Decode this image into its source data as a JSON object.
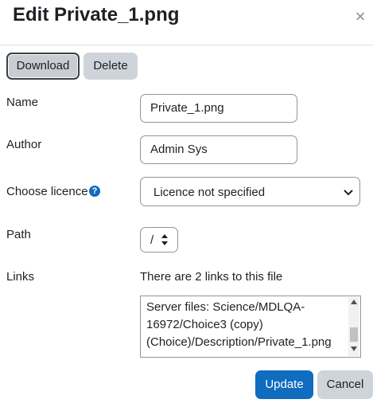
{
  "dialog": {
    "title": "Edit Private_1.png",
    "close_icon": "close-icon",
    "close_glyph": "×"
  },
  "toolbar": {
    "download_label": "Download",
    "delete_label": "Delete"
  },
  "form": {
    "name_label": "Name",
    "name_value": "Private_1.png",
    "author_label": "Author",
    "author_value": "Admin Sys",
    "licence_label": "Choose licence",
    "licence_help_icon": "question-circle-icon",
    "licence_help_glyph": "?",
    "licence_value": "Licence not specified",
    "path_label": "Path",
    "path_value": "/",
    "links_label": "Links",
    "links_summary": "There are 2 links to this file",
    "links_list_text": "Server files: Science/MDLQA-16972/Choice3 (copy) (Choice)/Description/Private_1.png"
  },
  "footer": {
    "update_label": "Update",
    "cancel_label": "Cancel"
  },
  "colors": {
    "primary": "#0f6cbf",
    "secondary": "#ced4da",
    "text": "#1d2125",
    "border": "#8f959e"
  }
}
